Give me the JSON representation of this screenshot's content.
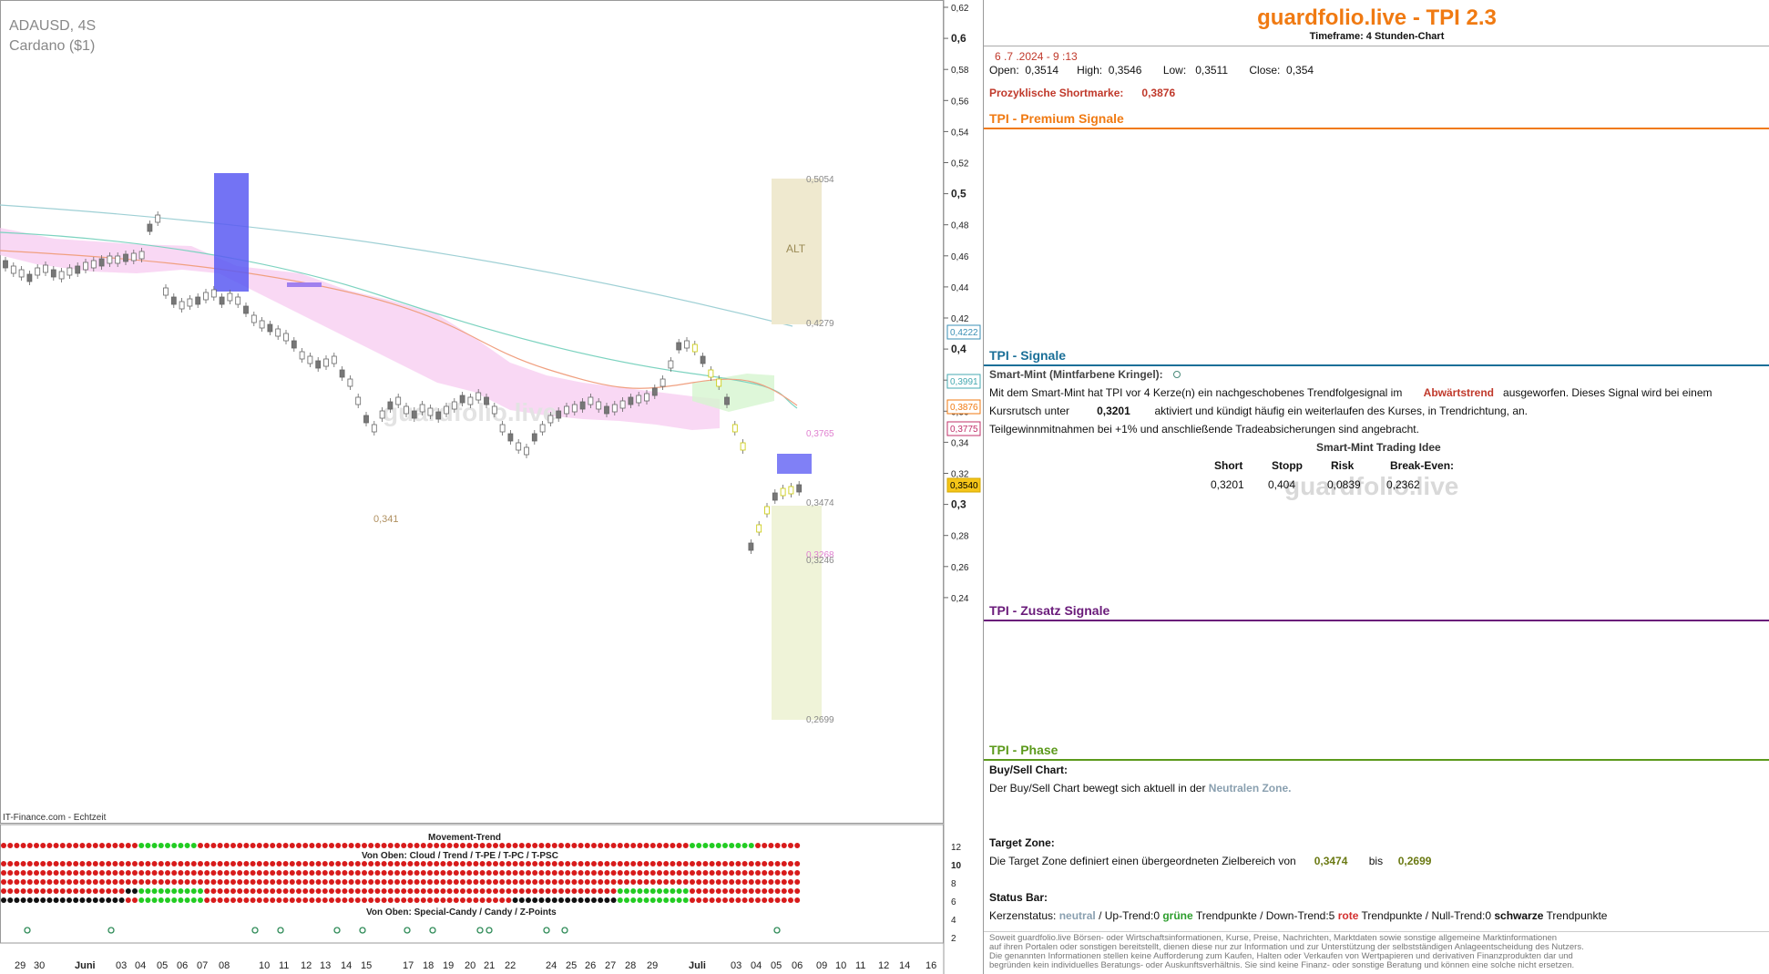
{
  "chart": {
    "symbol": "ADAUSD, 4S",
    "name": "Cardano ($1)",
    "source": "IT-Finance.com - Echtzeit",
    "watermark": "guardfolio.live",
    "y_ticks": [
      "0,62",
      "0,6",
      "0,58",
      "0,56",
      "0,54",
      "0,52",
      "0,5",
      "0,48",
      "0,46",
      "0,44",
      "0,42",
      "0,4",
      "0,38",
      "0,36",
      "0,34",
      "0,32",
      "0,3",
      "0,28",
      "0,26",
      "0,24"
    ],
    "price_tags": [
      {
        "label": "0,4222",
        "color": "#3a8fb5"
      },
      {
        "label": "0,3991",
        "color": "#44a8b0"
      },
      {
        "label": "0,3876",
        "color": "#f07a12"
      },
      {
        "label": "0,3775",
        "color": "#c0306a"
      },
      {
        "label": "0,3540",
        "color": "#d4a800"
      }
    ],
    "annotations": {
      "alt_label": "ALT",
      "level_top": "0,5054",
      "level_4279": "0,4279",
      "level_3765": "0,3765",
      "level_3474": "0,3474",
      "level_3268": "0,3268",
      "level_3246": "0,3246",
      "level_2699": "0,2699",
      "level_341": "0,341"
    },
    "x_labels": [
      "29",
      "30",
      "Juni",
      "03",
      "04",
      "05",
      "06",
      "07",
      "08",
      "10",
      "11",
      "12",
      "13",
      "14",
      "15",
      "17",
      "18",
      "19",
      "20",
      "21",
      "22",
      "24",
      "25",
      "26",
      "27",
      "28",
      "29",
      "Juli",
      "03",
      "04",
      "05",
      "06",
      "09",
      "10",
      "11",
      "12",
      "14",
      "16"
    ],
    "indicator": {
      "title_movement": "Movement-Trend",
      "title_cloud": "Von Oben: Cloud / Trend / T-PE / T-PC / T-PSC",
      "title_candy": "Von Oben: Special-Candy / Candy / Z-Points",
      "y_ticks": [
        "12",
        "10",
        "8",
        "6",
        "4",
        "2"
      ]
    }
  },
  "panel": {
    "brand": "guardfolio.live - TPI 2.3",
    "timeframe": "Timeframe: 4 Stunden-Chart",
    "datetime": "6 .7 .2024  - 9 :13",
    "ohlc": {
      "open_label": "Open:",
      "open": "0,3514",
      "high_label": "High:",
      "high": "0,3546",
      "low_label": "Low:",
      "low": "0,3511",
      "close_label": "Close:",
      "close": "0,354"
    },
    "short_label": "Prozyklische Shortmarke:",
    "short_value": "0,3876",
    "premium_title": "TPI - Premium Signale",
    "signale_title": "TPI - Signale",
    "smart_mint_title": "Smart-Mint (Mintfarbene Kringel):",
    "smart_mint_text1a": "Mit dem Smart-Mint hat TPI vor 4  Kerze(n) ein nachgeschobenes Trendfolgesignal im",
    "smart_mint_trend": "Abwärtstrend",
    "smart_mint_text1b": "ausgeworfen. Dieses Signal wird bei einem",
    "smart_mint_text2a": "Kursrutsch unter",
    "smart_mint_level": "0,3201",
    "smart_mint_text2b": "aktiviert und kündigt häufig ein weiterlaufen des Kurses, in Trendrichtung, an.",
    "smart_mint_text3": "Teilgewinnmitnahmen bei +1% und anschließende Tradeabsicherungen sind angebracht.",
    "trading_idea_title": "Smart-Mint Trading Idee",
    "trade": {
      "headers": [
        "Short",
        "Stopp",
        "Risk",
        "Break-Even:"
      ],
      "values": [
        "0,3201",
        "0,404",
        "0,0839",
        "0,2362"
      ]
    },
    "zusatz_title": "TPI - Zusatz Signale",
    "phase_title": "TPI - Phase",
    "buysell_title": "Buy/Sell Chart:",
    "buysell_text": "Der Buy/Sell Chart bewegt sich aktuell in der",
    "buysell_zone": "Neutralen Zone.",
    "target_title": "Target Zone:",
    "target_text": "Die Target Zone definiert einen übergeordneten Zielbereich von",
    "target_from": "0,3474",
    "target_bis": "bis",
    "target_to": "0,2699",
    "status_title": "Status Bar:",
    "status": {
      "prefix": "Kerzenstatus:",
      "state": "neutral",
      "up": "/ Up-Trend:0",
      "up_word": "grüne",
      "tp1": "Trendpunkte",
      "down": "/ Down-Trend:5",
      "down_word": "rote",
      "tp2": "Trendpunkte",
      "null": "/ Null-Trend:0",
      "null_word": "schwarze",
      "tp3": "Trendpunkte"
    },
    "disclaimer": [
      "Soweit guardfolio.live Börsen- oder Wirtschaftsinformationen, Kurse, Preise, Nachrichten, Marktdaten sowie sonstige allgemeine Marktinformationen",
      "auf ihren Portalen oder sonstigen bereitstellt, dienen diese nur zur Information und zur Unterstützung der selbstständigen Anlageentscheidung des Nutzers.",
      "Die genannten Informationen stellen keine Aufforderung zum Kaufen, Halten oder Verkaufen von Wertpapieren und derivativen Finanzprodukten dar und",
      "begründen kein individuelles Beratungs- oder Auskunftsverhältnis. Sie sind keine Finanz- oder sonstige Beratung und können eine solche nicht ersetzen."
    ]
  }
}
